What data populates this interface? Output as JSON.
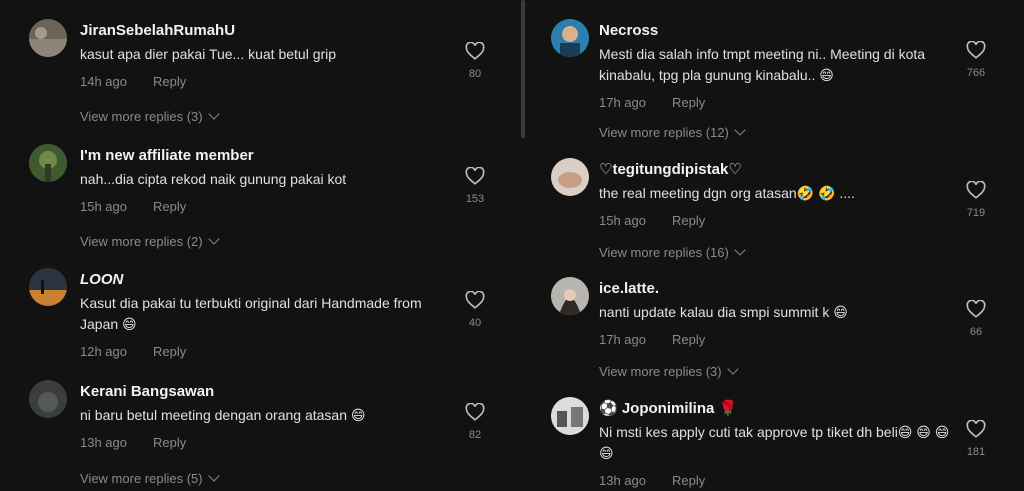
{
  "left": [
    {
      "user": "JiranSebelahRumahU",
      "text": "kasut apa dier pakai Tue... kuat betul grip",
      "time": "14h ago",
      "reply": "Reply",
      "likes": "80",
      "more": "View more replies (3)"
    },
    {
      "user": "I'm new affiliate member",
      "text": "nah...dia cipta rekod naik gunung pakai kot",
      "time": "15h ago",
      "reply": "Reply",
      "likes": "153",
      "more": "View more replies (2)"
    },
    {
      "user": "LOON",
      "text": "Kasut dia pakai tu terbukti original dari Handmade from Japan 😄",
      "time": "12h ago",
      "reply": "Reply",
      "likes": "40",
      "more": ""
    },
    {
      "user": "Kerani Bangsawan",
      "text": "ni baru betul meeting dengan orang atasan 😄",
      "time": "13h ago",
      "reply": "Reply",
      "likes": "82",
      "more": "View more replies (5)"
    }
  ],
  "right": [
    {
      "user": "Necross",
      "text": "Mesti dia salah info tmpt meeting ni.. Meeting di kota kinabalu, tpg pla gunung kinabalu.. 😄",
      "time": "17h ago",
      "reply": "Reply",
      "likes": "766",
      "more": "View more replies (12)"
    },
    {
      "user": "♡tegitungdipistak♡",
      "text": "the real meeting dgn org atasan🤣 🤣 ....",
      "time": "15h ago",
      "reply": "Reply",
      "likes": "719",
      "more": "View more replies (16)"
    },
    {
      "user": "ice.latte.",
      "text": "nanti update kalau dia smpi summit k 😄",
      "time": "17h ago",
      "reply": "Reply",
      "likes": "66",
      "more": "View more replies (3)"
    },
    {
      "user": "⚽ Joponimilina 🌹",
      "text": "Ni msti kes apply cuti tak approve tp tiket dh beli😄 😄 😄 😄",
      "time": "13h ago",
      "reply": "Reply",
      "likes": "181",
      "more": ""
    }
  ],
  "icons": {
    "like": "heart-outline-icon",
    "expand": "chevron-down-icon"
  },
  "colors": {
    "background": "#121212",
    "muted": "#8a8a8a",
    "text": "#e8e8e8"
  }
}
